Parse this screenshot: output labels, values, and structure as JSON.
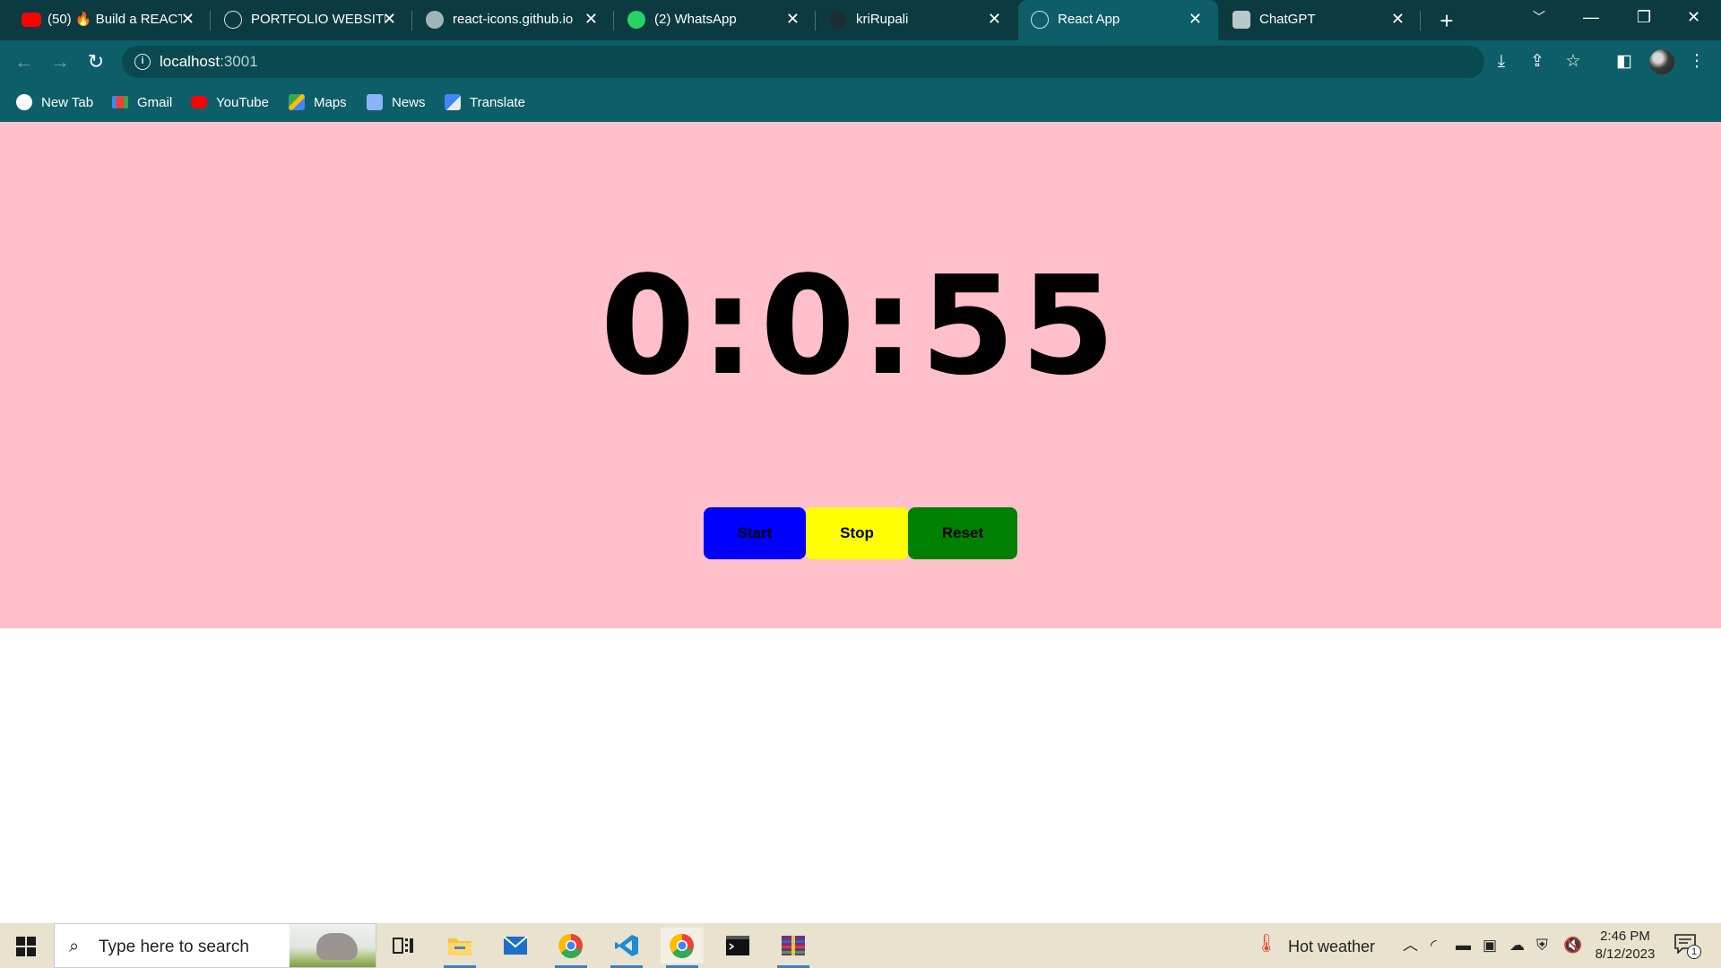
{
  "browser": {
    "tabs": [
      {
        "title": "(50) 🔥 Build a REACT",
        "icon": "youtube-icon",
        "active": false
      },
      {
        "title": "PORTFOLIO WEBSITE",
        "icon": "react-icon",
        "active": false
      },
      {
        "title": "react-icons.github.io",
        "icon": "globe-icon",
        "active": false
      },
      {
        "title": "(2) WhatsApp",
        "icon": "whatsapp-icon",
        "active": false
      },
      {
        "title": "kriRupali",
        "icon": "github-icon",
        "active": false
      },
      {
        "title": "React App",
        "icon": "react-icon",
        "active": true
      },
      {
        "title": "ChatGPT",
        "icon": "chatgpt-icon",
        "active": false
      }
    ],
    "address": {
      "host": "localhost",
      "port": ":3001"
    },
    "bookmarks": [
      {
        "label": "New Tab",
        "icon": "chrome-icon"
      },
      {
        "label": "Gmail",
        "icon": "gmail-icon"
      },
      {
        "label": "YouTube",
        "icon": "youtube-icon"
      },
      {
        "label": "Maps",
        "icon": "maps-icon"
      },
      {
        "label": "News",
        "icon": "news-icon"
      },
      {
        "label": "Translate",
        "icon": "translate-icon"
      }
    ]
  },
  "stopwatch": {
    "time": "0:0:55",
    "buttons": {
      "start": "Start",
      "stop": "Stop",
      "reset": "Reset"
    },
    "colors": {
      "background": "#ffc0cb",
      "start": "#0000ff",
      "stop": "#ffff00",
      "reset": "#008000"
    }
  },
  "taskbar": {
    "search_placeholder": "Type here to search",
    "weather": "Hot weather",
    "time": "2:46 PM",
    "date": "8/12/2023",
    "notification_count": "1"
  },
  "theme": {
    "tabstrip": "#0b3b41",
    "toolbar": "#0d5e69"
  }
}
